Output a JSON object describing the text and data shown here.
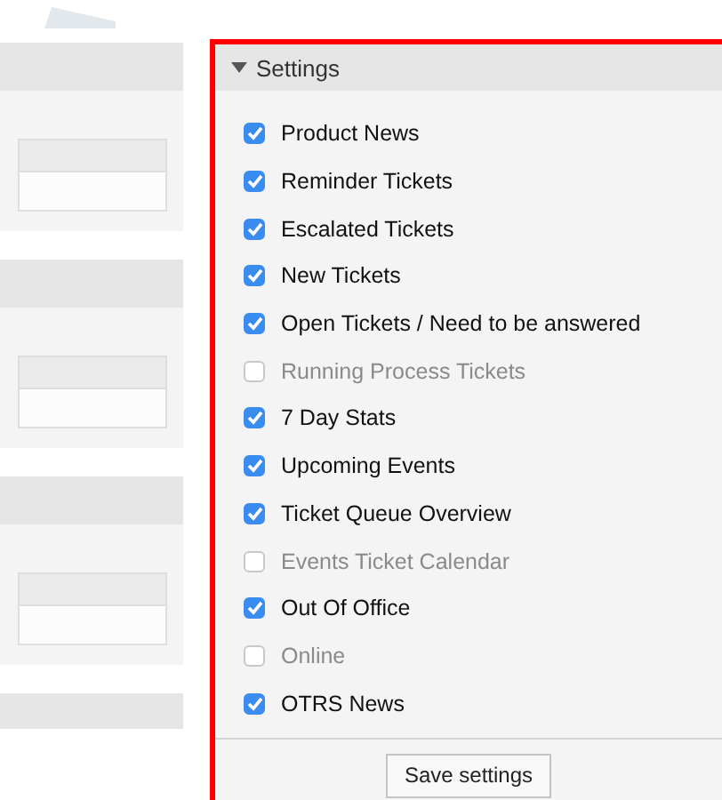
{
  "settings": {
    "title": "Settings",
    "expanded": true,
    "items": [
      {
        "label": "Product News",
        "checked": true
      },
      {
        "label": "Reminder Tickets",
        "checked": true
      },
      {
        "label": "Escalated Tickets",
        "checked": true
      },
      {
        "label": "New Tickets",
        "checked": true
      },
      {
        "label": "Open Tickets / Need to be answered",
        "checked": true
      },
      {
        "label": "Running Process Tickets",
        "checked": false
      },
      {
        "label": "7 Day Stats",
        "checked": true
      },
      {
        "label": "Upcoming Events",
        "checked": true
      },
      {
        "label": "Ticket Queue Overview",
        "checked": true
      },
      {
        "label": "Events Ticket Calendar",
        "checked": false
      },
      {
        "label": "Out Of Office",
        "checked": true
      },
      {
        "label": "Online",
        "checked": false
      },
      {
        "label": "OTRS News",
        "checked": true
      }
    ],
    "save_button": "Save settings"
  }
}
